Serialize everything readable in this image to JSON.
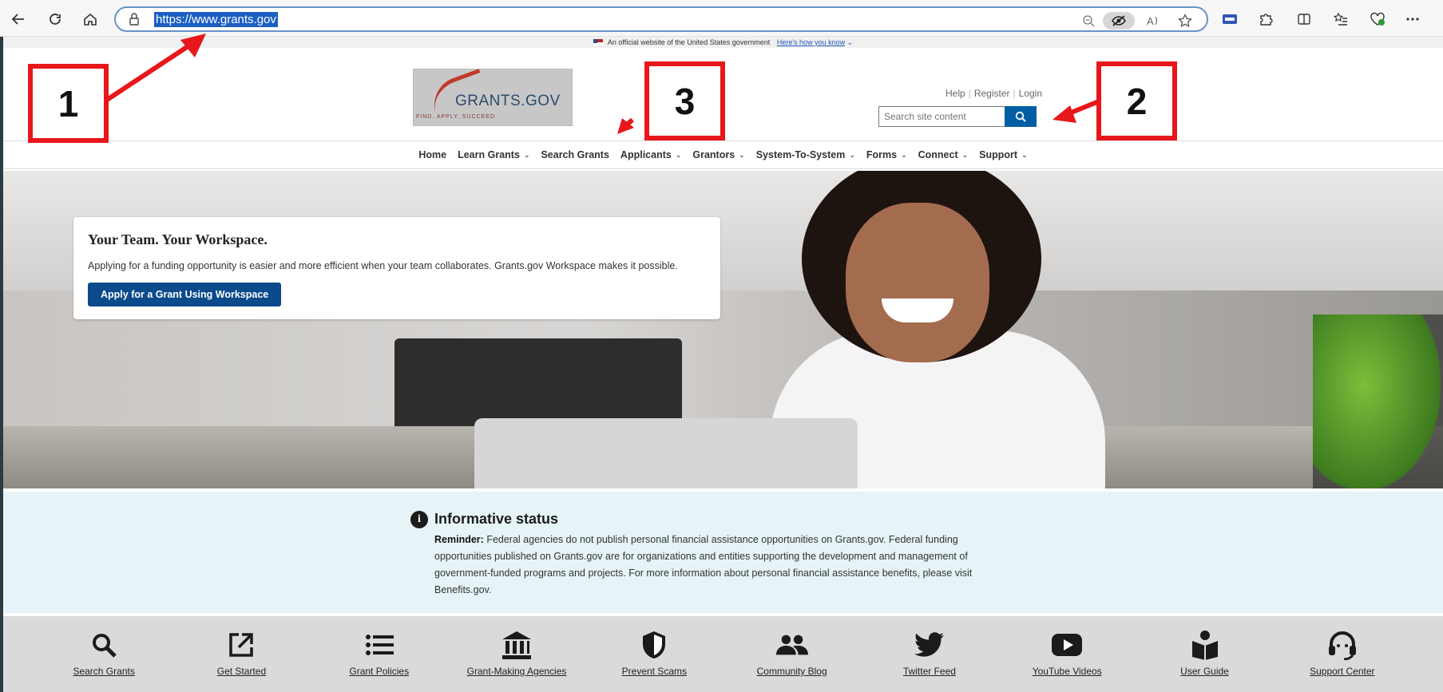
{
  "browser": {
    "url": "https://www.grants.gov",
    "icons": [
      "back-icon",
      "refresh-icon",
      "home-icon",
      "lock-icon",
      "zoom-out-icon",
      "tracking-prevention-icon",
      "read-aloud-icon",
      "favorite-star-icon",
      "extension-icon",
      "puzzle-icon",
      "split-screen-icon",
      "favorites-icon",
      "browser-essentials-icon",
      "more-icon"
    ]
  },
  "gov_banner": {
    "text": "An official website of the United States government",
    "link": "Here's how you know"
  },
  "logo": {
    "wordmark": "GRANTS.GOV",
    "tagline": "FIND. APPLY. SUCCEED."
  },
  "utility": {
    "help": "Help",
    "register": "Register",
    "login": "Login",
    "search_placeholder": "Search site content"
  },
  "nav": [
    {
      "label": "Home",
      "dropdown": false
    },
    {
      "label": "Learn Grants",
      "dropdown": true
    },
    {
      "label": "Search Grants",
      "dropdown": false
    },
    {
      "label": "Applicants",
      "dropdown": true
    },
    {
      "label": "Grantors",
      "dropdown": true
    },
    {
      "label": "System-To-System",
      "dropdown": true
    },
    {
      "label": "Forms",
      "dropdown": true
    },
    {
      "label": "Connect",
      "dropdown": true
    },
    {
      "label": "Support",
      "dropdown": true
    }
  ],
  "hero": {
    "title": "Your Team. Your Workspace.",
    "body": "Applying for a funding opportunity is easier and more efficient when your team collaborates. Grants.gov Workspace makes it possible.",
    "button": "Apply for a Grant Using Workspace"
  },
  "info": {
    "title": "Informative status",
    "reminder_label": "Reminder:",
    "reminder_text": "Federal agencies do not publish personal financial assistance opportunities on Grants.gov. Federal funding opportunities published on Grants.gov are for organizations and entities supporting the development and management of government-funded programs and projects. For more information about personal financial assistance benefits, please visit Benefits.gov."
  },
  "footer": [
    {
      "label": "Search Grants",
      "icon": "search-icon"
    },
    {
      "label": "Get Started",
      "icon": "external-link-icon"
    },
    {
      "label": "Grant Policies",
      "icon": "list-icon"
    },
    {
      "label": "Grant-Making Agencies",
      "icon": "bank-icon"
    },
    {
      "label": "Prevent Scams",
      "icon": "shield-icon"
    },
    {
      "label": "Community Blog",
      "icon": "people-icon"
    },
    {
      "label": "Twitter Feed",
      "icon": "twitter-icon"
    },
    {
      "label": "YouTube Videos",
      "icon": "youtube-icon"
    },
    {
      "label": "User Guide",
      "icon": "user-guide-icon"
    },
    {
      "label": "Support Center",
      "icon": "headset-icon"
    }
  ],
  "annotations": [
    "1",
    "2",
    "3"
  ],
  "colors": {
    "annotation": "#e8171b",
    "primary_button": "#0b4a8b",
    "search_button": "#005ea2",
    "info_bg": "#e6f4f7"
  }
}
